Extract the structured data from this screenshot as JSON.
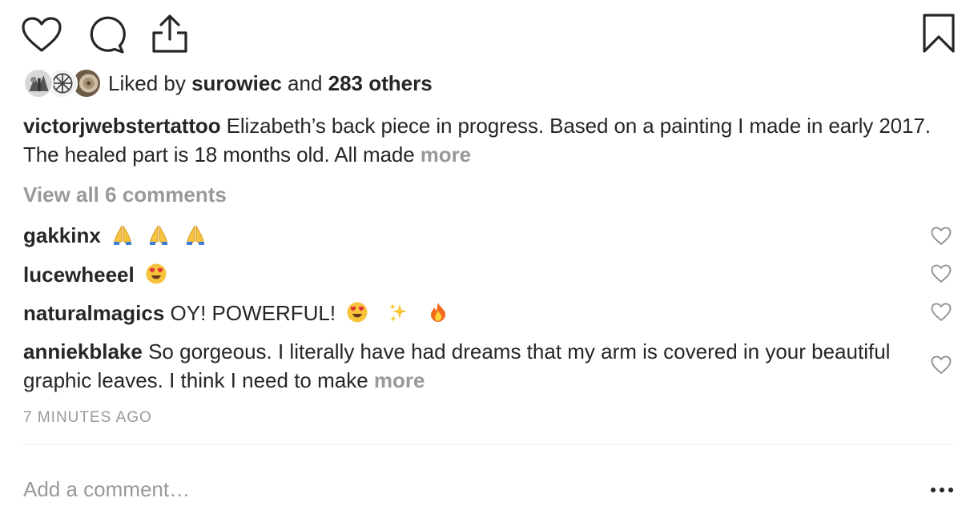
{
  "actions": {
    "like_icon": "heart-outline-icon",
    "comment_icon": "comment-bubble-icon",
    "share_icon": "share-upload-icon",
    "save_icon": "bookmark-icon"
  },
  "likes": {
    "prefix": "Liked by ",
    "user": "surowiec",
    "connector": " and ",
    "others": "283 others"
  },
  "caption": {
    "username": "victorjwebstertattoo",
    "text": " Elizabeth’s back piece in progress. Based on a painting I made in early 2017. The healed part is 18 months old. All made ",
    "more": "more"
  },
  "view_all": "View all 6 comments",
  "comments": [
    {
      "user": "gakkinx",
      "text": "",
      "emojis": [
        "folded-hands",
        "folded-hands",
        "folded-hands"
      ]
    },
    {
      "user": "lucewheeel",
      "text": "",
      "emojis": [
        "heart-eyes"
      ]
    },
    {
      "user": "naturalmagics",
      "text": " OY! POWERFUL!",
      "emojis": [
        "heart-eyes",
        "sparkles",
        "fire"
      ]
    },
    {
      "user": "anniekblake",
      "text": " So gorgeous. I literally have had dreams that my arm is covered in your beautiful graphic leaves. I think I need to make ",
      "more": "more"
    }
  ],
  "timestamp": "7 MINUTES AGO",
  "add_comment": {
    "placeholder": "Add a comment…"
  },
  "options_icon": "more-horizontal-icon",
  "colors": {
    "text": "#262626",
    "muted": "#999999",
    "divider": "#efefef",
    "small_heart": "#8e8e8e"
  }
}
